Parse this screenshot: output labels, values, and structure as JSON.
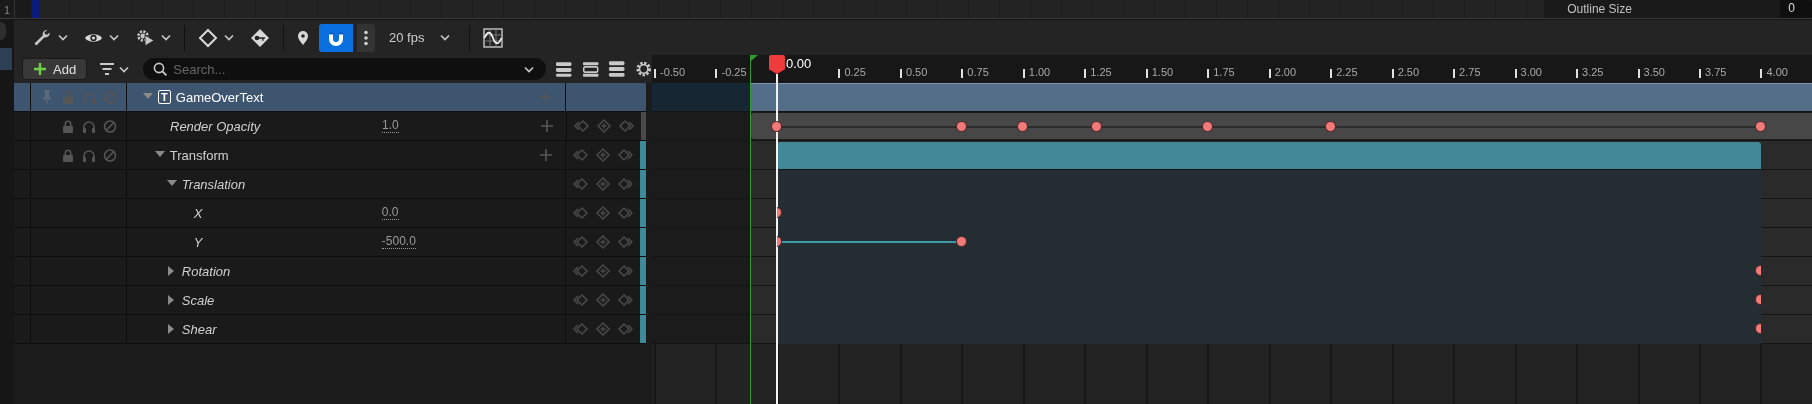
{
  "top_strip": {
    "row_number": "1",
    "property_label": "Outline Size",
    "property_value": "0"
  },
  "toolbar": {
    "fps": "20 fps",
    "snap": {
      "selected": true
    }
  },
  "add_button": "Add",
  "search": {
    "placeholder": "Search..."
  },
  "tracks": [
    {
      "name": "GameOverText",
      "kind": "object",
      "type_icon": "T",
      "selected": true,
      "expanded": true,
      "children": [
        {
          "name": "Render Opacity",
          "kind": "property",
          "selected": false,
          "value": "1.0",
          "keys": [
            {
              "level": 0
            },
            {
              "level": 0.1875
            },
            {
              "level": 0.25
            },
            {
              "level": 0.325
            },
            {
              "level": 0.4375
            },
            {
              "level": 0.5625
            },
            {
              "level": 1
            }
          ]
        },
        {
          "name": "Transform",
          "kind": "section",
          "selected": false,
          "expanded": true,
          "children": [
            {
              "name": "Translation",
              "kind": "channel",
              "selected": false,
              "expanded": true,
              "children": [
                {
                  "name": "X",
                  "kind": "channel",
                  "selected": false,
                  "value": "0.0",
                  "keys": [
                    {
                      "level": 0
                    }
                  ]
                },
                {
                  "name": "Y",
                  "kind": "channel",
                  "selected": false,
                  "value": "-500.0",
                  "keys": [
                    {
                      "level": 0
                    },
                    {
                      "level": 0.1875
                    }
                  ]
                }
              ]
            },
            {
              "name": "Rotation",
              "kind": "channel",
              "selected": false,
              "expanded": false,
              "keys": [
                {
                  "level": 1
                }
              ]
            },
            {
              "name": "Scale",
              "kind": "channel",
              "selected": false,
              "expanded": false,
              "keys": [
                {
                  "level": 1
                }
              ]
            },
            {
              "name": "Shear",
              "kind": "channel",
              "selected": false,
              "expanded": false,
              "keys": [
                {
                  "level": 1
                }
              ]
            }
          ]
        }
      ]
    }
  ],
  "timeline": {
    "playhead": "0.00",
    "ticks_before": [
      "-0.50",
      "-0.25"
    ],
    "ticks_after": [
      "0.25",
      "0.50",
      "0.75",
      "1.00",
      "1.25",
      "1.50",
      "1.75",
      "2.00",
      "2.25",
      "2.50",
      "2.75",
      "3.00",
      "3.25",
      "3.50",
      "3.75",
      "4.00"
    ]
  }
}
